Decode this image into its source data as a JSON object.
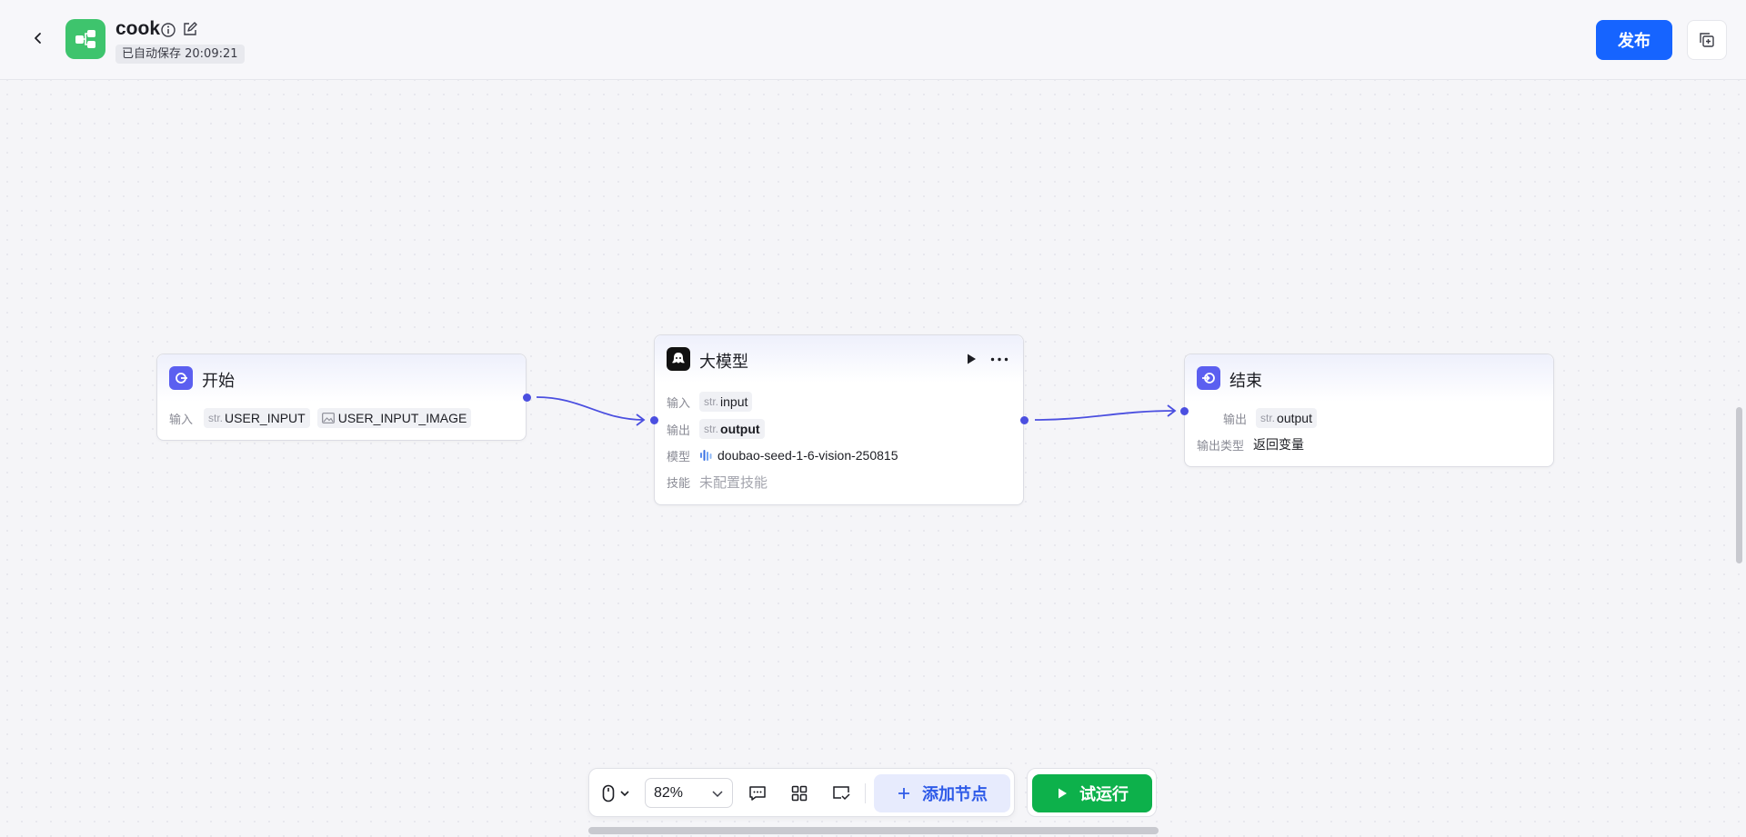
{
  "header": {
    "app_name": "cook",
    "autosave_text": "已自动保存 20:09:21",
    "publish_label": "发布"
  },
  "nodes": {
    "start": {
      "title": "开始",
      "input_label": "输入",
      "inputs": [
        {
          "type": "str.",
          "name": "USER_INPUT"
        },
        {
          "type": "image",
          "name": "USER_INPUT_IMAGE"
        }
      ]
    },
    "llm": {
      "title": "大模型",
      "input_label": "输入",
      "input_type": "str.",
      "input_name": "input",
      "output_label": "输出",
      "output_type": "str.",
      "output_name": "output",
      "model_label": "模型",
      "model_name": "doubao-seed-1-6-vision-250815",
      "skill_label": "技能",
      "skill_value": "未配置技能"
    },
    "end": {
      "title": "结束",
      "output_label": "输出",
      "output_type": "str.",
      "output_name": "output",
      "output_type_label": "输出类型",
      "output_type_value": "返回变量"
    }
  },
  "toolbar": {
    "zoom": "82%",
    "add_node_label": "添加节点",
    "run_label": "试运行"
  },
  "colors": {
    "primary": "#1664ff",
    "node_accent": "#5b5ff0",
    "run_green": "#0db14b",
    "app_icon_green": "#3ec46d"
  }
}
